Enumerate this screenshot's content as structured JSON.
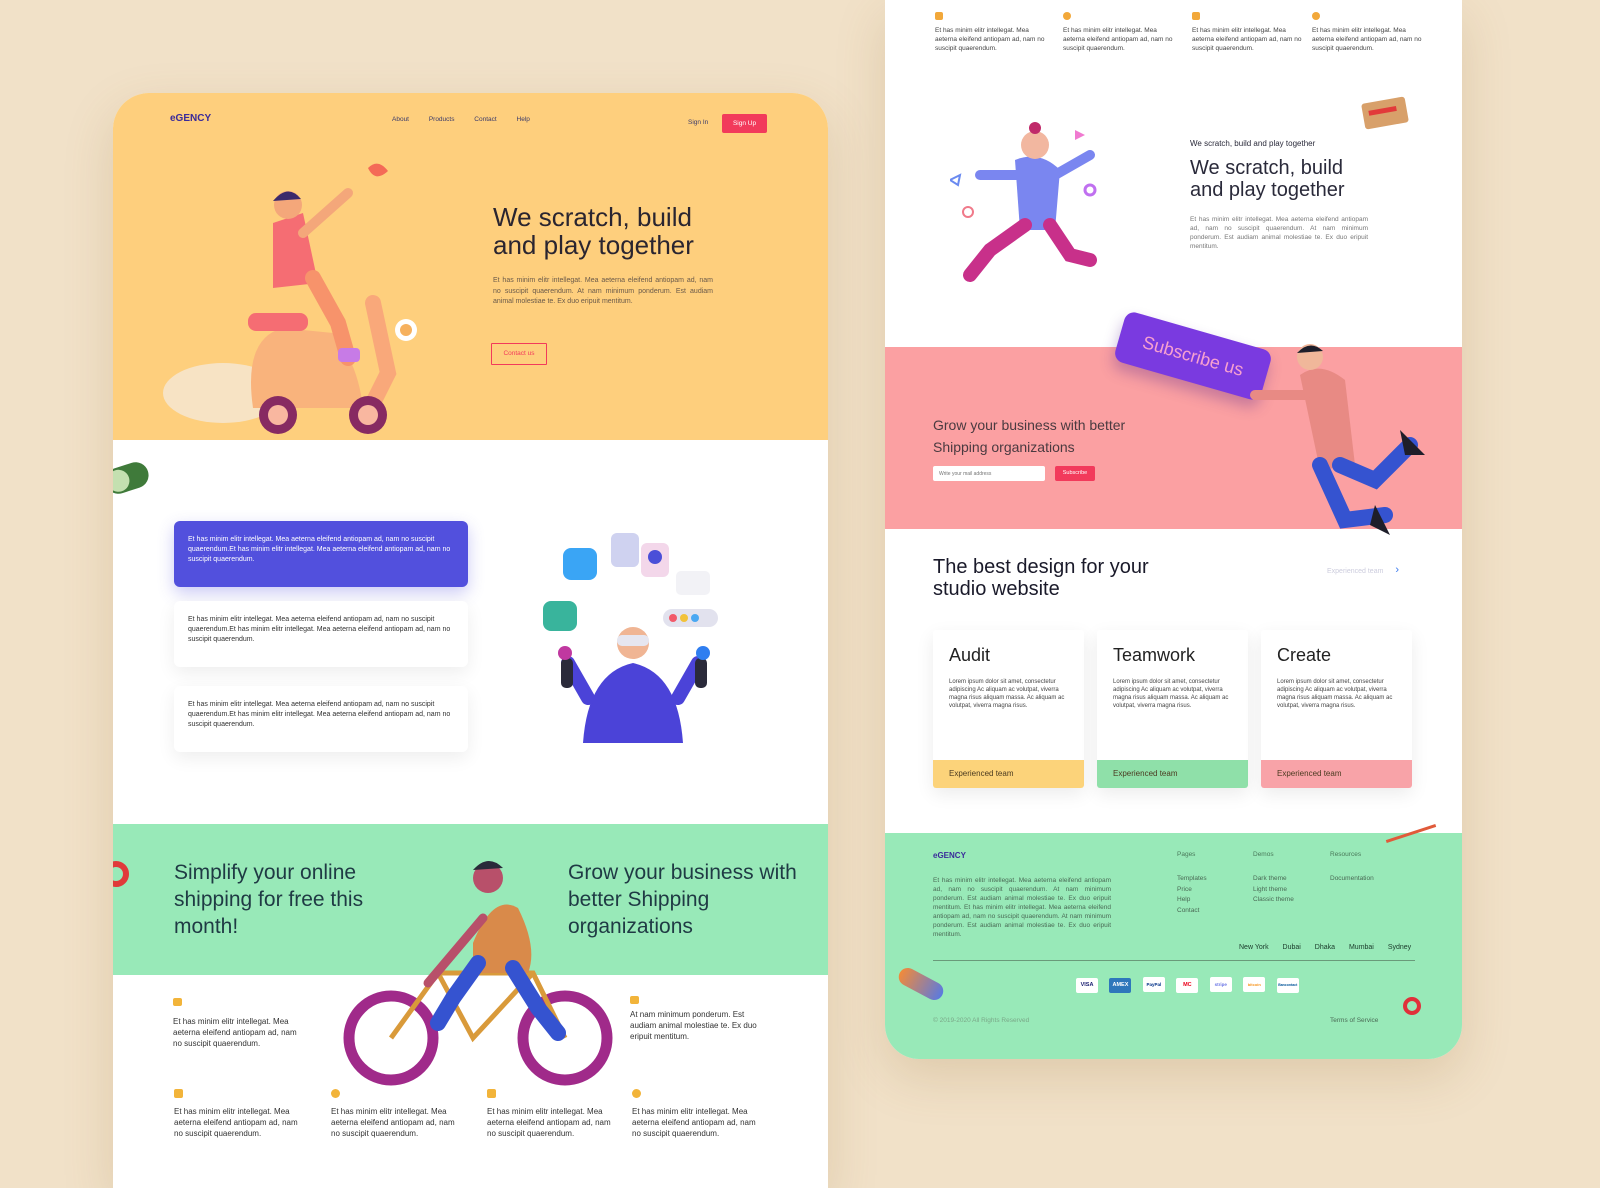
{
  "left_page": {
    "logo": "eGENCY",
    "nav": [
      "About",
      "Products",
      "Contact",
      "Help"
    ],
    "sign_in": "Sign In",
    "sign_up": "Sign Up",
    "hero_title_line1": "We scratch, build",
    "hero_title_line2": "and play together",
    "hero_body": "Et has minim elitr intellegat. Mea aeterna eleifend antiopam ad, nam no suscipit quaerendum. At nam minimum ponderum. Est audiam animal molestiae te. Ex duo eripuit mentitum.",
    "contact_button": "Contact us",
    "features": [
      "Et has minim elitr intellegat. Mea aeterna eleifend antiopam ad, nam no suscipit quaerendum.Et has minim elitr intellegat. Mea aeterna eleifend antiopam ad, nam no suscipit quaerendum.",
      "Et has minim elitr intellegat. Mea aeterna eleifend antiopam ad, nam no suscipit quaerendum.Et has minim elitr intellegat. Mea aeterna eleifend antiopam ad, nam no suscipit quaerendum.",
      "Et has minim elitr intellegat. Mea aeterna eleifend antiopam ad, nam no suscipit quaerendum.Et has minim elitr intellegat. Mea aeterna eleifend antiopam ad, nam no suscipit quaerendum."
    ],
    "banner_left": "Simplify your online shipping for free this month!",
    "banner_right": "Grow your business with better Shipping organizations",
    "side_text_left": "Et has minim elitr intellegat. Mea aeterna eleifend antiopam ad, nam no suscipit quaerendum.",
    "side_text_right": "At nam minimum ponderum. Est audiam animal molestiae te. Ex duo eripuit mentitum.",
    "bottom_items": [
      "Et has minim elitr intellegat. Mea aeterna eleifend antiopam ad, nam no suscipit quaerendum.",
      "Et has minim elitr intellegat. Mea aeterna eleifend antiopam ad, nam no suscipit quaerendum.",
      "Et has minim elitr intellegat. Mea aeterna eleifend antiopam ad, nam no suscipit quaerendum.",
      "Et has minim elitr intellegat. Mea aeterna eleifend antiopam ad, nam no suscipit quaerendum."
    ]
  },
  "right_page": {
    "top_items": [
      "Et has minim elitr intellegat. Mea aeterna eleifend antiopam ad, nam no suscipit quaerendum.",
      "Et has minim elitr intellegat. Mea aeterna eleifend antiopam ad, nam no suscipit quaerendum.",
      "Et has minim elitr intellegat. Mea aeterna eleifend antiopam ad, nam no suscipit quaerendum.",
      "Et has minim elitr intellegat. Mea aeterna eleifend antiopam ad, nam no suscipit quaerendum."
    ],
    "section_eyebrow": "We scratch, build and play together",
    "section_title_line1": "We scratch, build",
    "section_title_line2": "and play together",
    "section_body": "Et has minim elitr intellegat. Mea aeterna eleifend antiopam ad, nam no suscipit quaerendum. At nam minimum ponderum. Est audiam animal molestiae te. Ex duo eripuit mentitum.",
    "subscribe_sign": "Subscribe us",
    "subscribe_title_line1": "Grow your business with better",
    "subscribe_title_line2": "Shipping organizations",
    "email_placeholder": "Write your mail address",
    "subscribe_button": "Subscribe",
    "best_title_line1": "The best design for your",
    "best_title_line2": "studio website",
    "experienced_link": "Experienced team",
    "cards": [
      {
        "title": "Audit",
        "body": "Lorem ipsum dolor sit amet, consectetur adipiscing Ac aliquam ac volutpat, viverra magna risus aliquam massa. Ac aliquam ac volutpat, viverra magna risus.",
        "footer": "Experienced team",
        "color": "#fcd37a"
      },
      {
        "title": "Teamwork",
        "body": "Lorem ipsum dolor sit amet, consectetur adipiscing Ac aliquam ac volutpat, viverra magna risus aliquam massa. Ac aliquam ac volutpat, viverra magna risus.",
        "footer": "Experienced team",
        "color": "#8fe0a9"
      },
      {
        "title": "Create",
        "body": "Lorem ipsum dolor sit amet, consectetur adipiscing Ac aliquam ac volutpat, viverra magna risus aliquam massa. Ac aliquam ac volutpat, viverra magna risus.",
        "footer": "Experienced team",
        "color": "#f8a3a8"
      }
    ],
    "footer": {
      "logo": "eGENCY",
      "about": "Et has minim elitr intellegat. Mea aeterna eleifend antiopam ad, nam no suscipit quaerendum. At nam minimum ponderum. Est audiam animal molestiae te. Ex duo eripuit mentitum. Et has minim elitr intellegat. Mea aeterna eleifend antiopam ad, nam no suscipit quaerendum. At nam minimum ponderum. Est audiam animal molestiae te. Ex duo eripuit mentitum.",
      "col_pages_title": "Pages",
      "col_pages": [
        "Templates",
        "Price",
        "Help",
        "Contact"
      ],
      "col_demos_title": "Demos",
      "col_demos": [
        "Dark theme",
        "Light theme",
        "Classic theme"
      ],
      "col_resources_title": "Resources",
      "col_resources": [
        "Documentation"
      ],
      "cities": [
        "New York",
        "Dubai",
        "Dhaka",
        "Mumbai",
        "Sydney"
      ],
      "payments": [
        "VISA",
        "AMEX",
        "PayPal",
        "MC",
        "stripe",
        "bitcoin",
        "Bancontact"
      ],
      "copyright": "© 2019-2020 All Rights Reserved",
      "terms": "Terms of Service"
    }
  },
  "colors": {
    "page_bg": "#f1e1c8",
    "hero_yellow": "#fecf7d",
    "accent_red": "#f23a5b",
    "accent_purple": "#5250dd",
    "mint": "#98e9b8",
    "pink": "#fba0a2"
  }
}
